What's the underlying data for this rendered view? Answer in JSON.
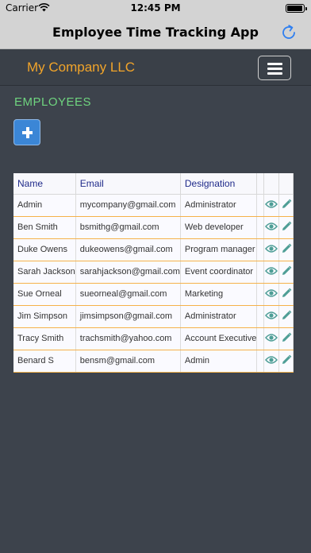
{
  "status_bar": {
    "carrier": "Carrier",
    "time": "12:45 PM"
  },
  "nav": {
    "title": "Employee Time Tracking App",
    "refresh_icon": "refresh-icon"
  },
  "header": {
    "company": "My Company LLC",
    "menu_icon": "hamburger-menu-icon"
  },
  "section": {
    "title": "EMPLOYEES",
    "add_icon": "plus-icon"
  },
  "table": {
    "columns": [
      "Name",
      "Email",
      "Designation"
    ],
    "rows": [
      {
        "name": "Admin",
        "email": "mycompany@gmail.com",
        "designation": "Administrator"
      },
      {
        "name": "Ben Smith",
        "email": "bsmithg@gmail.com",
        "designation": "Web developer"
      },
      {
        "name": "Duke Owens",
        "email": "dukeowens@gmail.com",
        "designation": "Program manager"
      },
      {
        "name": "Sarah Jackson",
        "email": "sarahjackson@gmail.com",
        "designation": "Event coordinator"
      },
      {
        "name": "Sue Orneal",
        "email": "sueorneal@gmail.com",
        "designation": "Marketing"
      },
      {
        "name": "Jim Simpson",
        "email": "jimsimpson@gmail.com",
        "designation": "Administrator"
      },
      {
        "name": "Tracy Smith",
        "email": "trachsmith@yahoo.com",
        "designation": "Account Executive"
      },
      {
        "name": "Benard S",
        "email": "bensm@gmail.com",
        "designation": "Admin"
      }
    ],
    "row_icons": [
      "eye-icon",
      "pencil-icon"
    ]
  },
  "colors": {
    "accent": "#f1a42a",
    "section_title": "#6fd47f",
    "add_button": "#3b86d6",
    "icon": "#4e9e96",
    "background": "#3d434c"
  }
}
